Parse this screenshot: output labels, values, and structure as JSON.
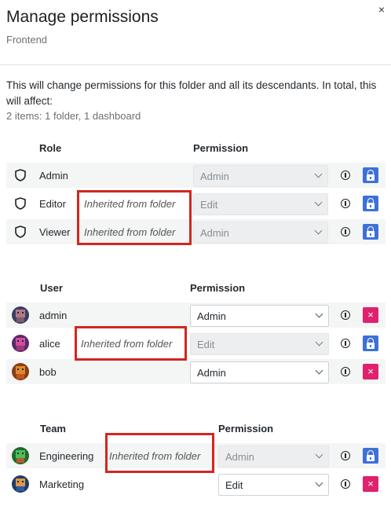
{
  "dialog": {
    "title": "Manage permissions",
    "subtitle": "Frontend",
    "close_icon": "×"
  },
  "info": {
    "line1": "This will change permissions for this folder and all its descendants. In total, this will affect:",
    "line2": "2 items: 1 folder, 1 dashboard"
  },
  "roles": {
    "header": "Role",
    "permission_header": "Permission",
    "items": [
      {
        "name": "Admin",
        "inherited": "",
        "permission": "Admin",
        "disabled": true,
        "action": "lock"
      },
      {
        "name": "Editor",
        "inherited": "Inherited from folder",
        "permission": "Edit",
        "disabled": true,
        "action": "lock"
      },
      {
        "name": "Viewer",
        "inherited": "Inherited from folder",
        "permission": "Admin",
        "disabled": true,
        "action": "lock"
      }
    ]
  },
  "users": {
    "header": "User",
    "permission_header": "Permission",
    "items": [
      {
        "name": "admin",
        "inherited": "",
        "permission": "Admin",
        "disabled": false,
        "action": "remove"
      },
      {
        "name": "alice",
        "inherited": "Inherited from folder",
        "permission": "Edit",
        "disabled": true,
        "action": "lock"
      },
      {
        "name": "bob",
        "inherited": "",
        "permission": "Admin",
        "disabled": false,
        "action": "remove"
      }
    ]
  },
  "teams": {
    "header": "Team",
    "permission_header": "Permission",
    "items": [
      {
        "name": "Engineering",
        "inherited": "Inherited from folder",
        "permission": "Admin",
        "disabled": true,
        "action": "lock"
      },
      {
        "name": "Marketing",
        "inherited": "",
        "permission": "Edit",
        "disabled": false,
        "action": "remove"
      }
    ]
  },
  "actions": {
    "remove_icon": "×"
  },
  "colors": {
    "lock_button": "#3d71d9",
    "remove_button": "#e0226e",
    "highlight_box": "#d3261f"
  }
}
